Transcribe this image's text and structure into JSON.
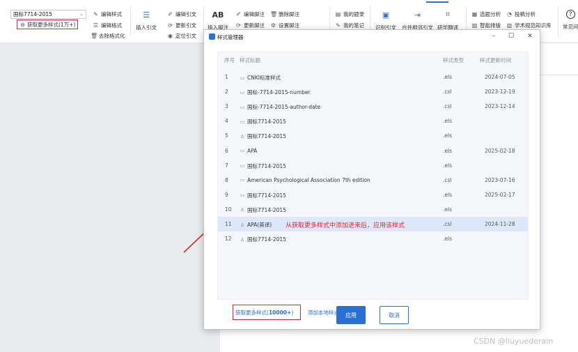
{
  "ribbon": {
    "style_select_value": "国标7714-2015",
    "get_more_styles": "获取更多样式(1万+)",
    "edit_style": "编辑样式",
    "edit_format": "编辑格式",
    "remove_format": "去除格式化",
    "insert_citation": "插入引文",
    "edit_citation": "编辑引文",
    "update_citation": "更新引文",
    "locate_citation": "定位引文",
    "insert_footnote": "插入脚注",
    "edit_footnote": "编辑脚注",
    "update_footnote": "更新脚注",
    "delete_footnote": "删除脚注",
    "set_footnote": "设置脚注",
    "my_clips": "我的题录",
    "my_notes": "我的笔记",
    "recognize_citation": "识别引文",
    "merge_citation": "合并相邻引文",
    "research_translate": "研学翻译",
    "topic_analysis": "选题分析",
    "submission_analysis": "投稿分析",
    "smart_layout": "智能排版",
    "academic_kb": "学术规范知识库",
    "faq": "常见问"
  },
  "dialog": {
    "title": "样式管理器",
    "columns": {
      "no": "序号",
      "title": "样式标题",
      "type": "样式类型",
      "updated": "样式更新时间"
    },
    "rows": [
      {
        "no": "1",
        "icon": "doc-icon",
        "title": "CNKI标准样式",
        "type": ".els",
        "updated": "2024-07-05"
      },
      {
        "no": "2",
        "icon": "doc-icon",
        "title": "国标-7714-2015-number",
        "type": ".csl",
        "updated": "2023-12-19"
      },
      {
        "no": "3",
        "icon": "doc-icon",
        "title": "国标-7714-2015-author-date",
        "type": ".csl",
        "updated": "2023-12-14"
      },
      {
        "no": "4",
        "icon": "doc-icon",
        "title": "国标7714-2015",
        "type": ".els",
        "updated": ""
      },
      {
        "no": "5",
        "icon": "user-icon",
        "title": "国标7714-2015",
        "type": ".els",
        "updated": ""
      },
      {
        "no": "6",
        "icon": "doc-icon",
        "title": "APA",
        "type": ".els",
        "updated": "2025-02-18"
      },
      {
        "no": "7",
        "icon": "doc-icon",
        "title": "国标7714-2015",
        "type": ".els",
        "updated": ""
      },
      {
        "no": "8",
        "icon": "doc-icon",
        "title": "American Psychological Association 7th edition",
        "type": ".csl",
        "updated": "2023-07-16"
      },
      {
        "no": "9",
        "icon": "doc-icon",
        "title": "国标7714-2015",
        "type": ".els",
        "updated": "2025-02-17"
      },
      {
        "no": "10",
        "icon": "user-icon",
        "title": "国标7714-2015",
        "type": ".els",
        "updated": ""
      },
      {
        "no": "11",
        "icon": "user-icon",
        "title": "APA(英译)",
        "type": ".csl",
        "updated": "2024-11-28"
      },
      {
        "no": "12",
        "icon": "user-icon",
        "title": "国标7714-2015",
        "type": ".els",
        "updated": ""
      }
    ],
    "selected_row": 11,
    "annotation": "从获取更多样式中添加进来后，应用该样式",
    "get_more_link_prefix": "获取更多样式(",
    "get_more_link_count": "10000+",
    "get_more_link_suffix": ")",
    "add_local_style": "添加本地样式",
    "apply_button": "应用",
    "cancel_button": "取消"
  },
  "watermark": "CSDN @liuyuederain",
  "colors": {
    "accent": "#2a6fd6",
    "highlight": "#e0262b",
    "selected_row": "#dde8fb"
  }
}
